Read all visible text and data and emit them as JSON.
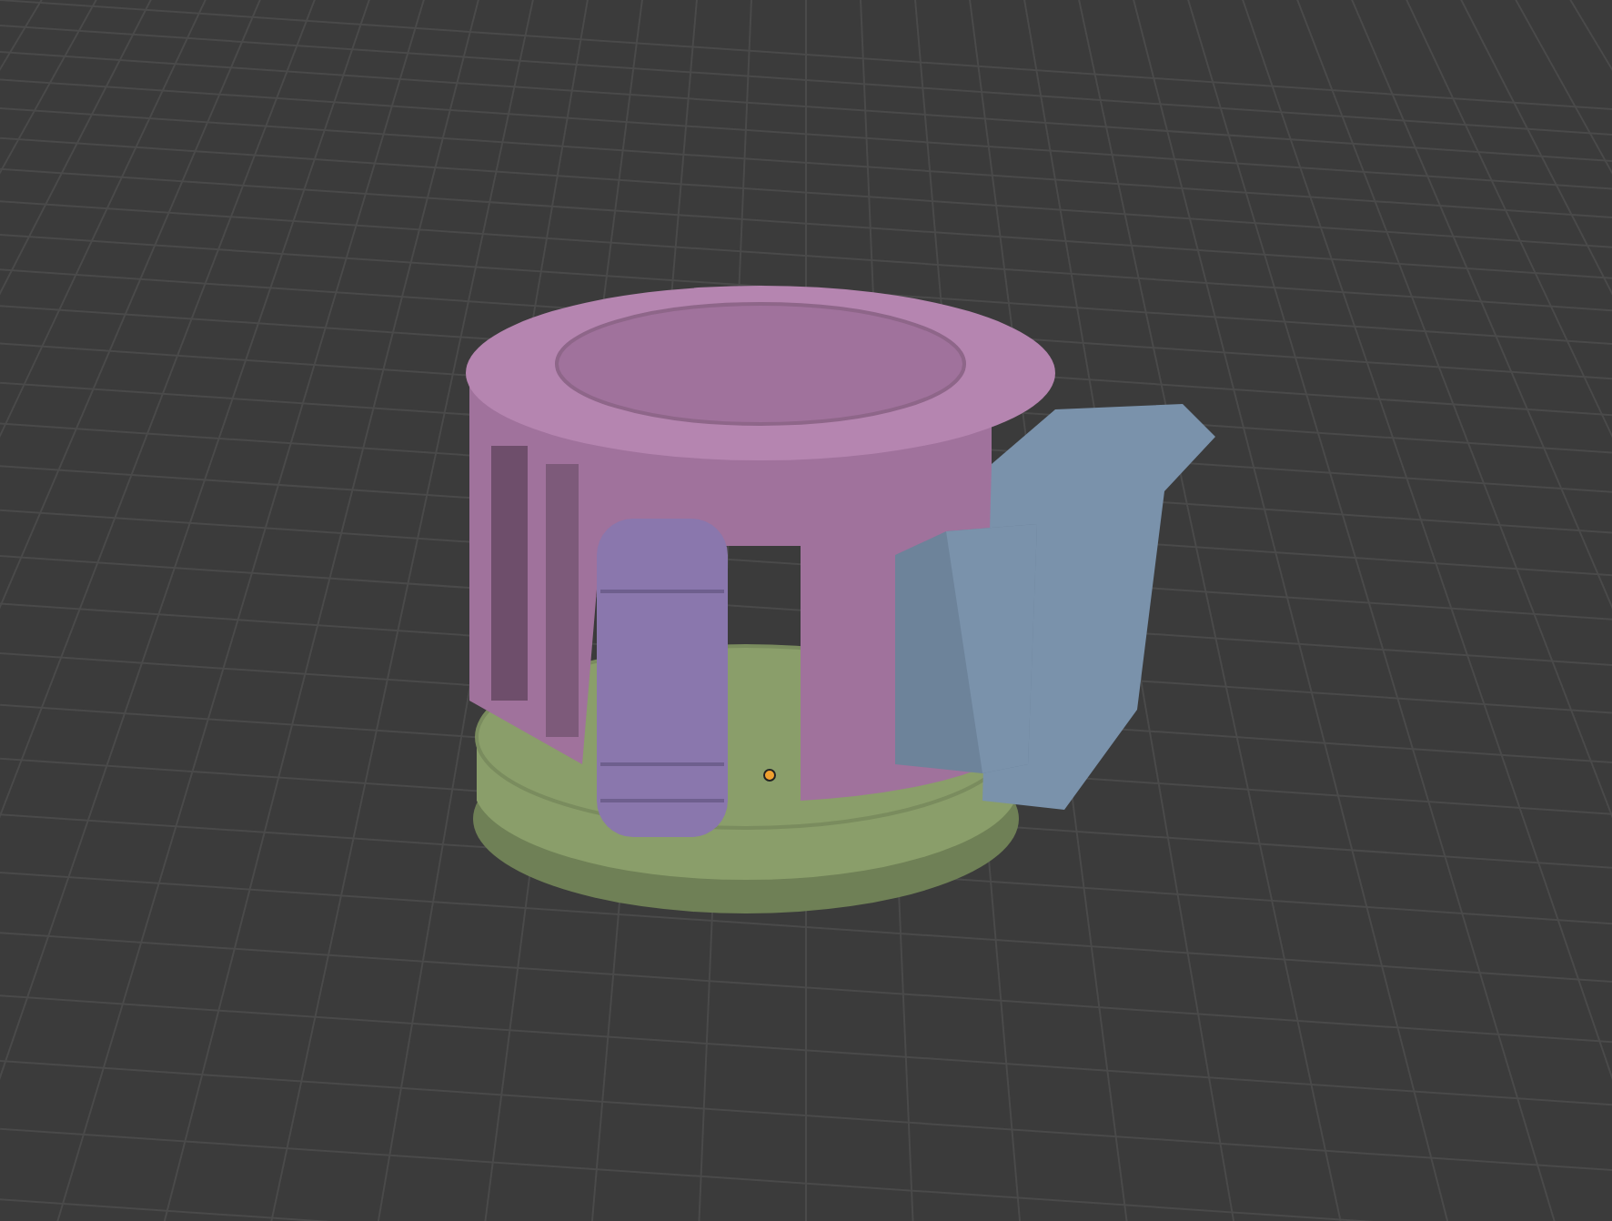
{
  "viewport": {
    "origin_marker": true
  },
  "model": {
    "parts": [
      {
        "kind": "base",
        "color": "#8a9e6a"
      },
      {
        "kind": "body",
        "color": "#a0729c"
      },
      {
        "kind": "roller",
        "color": "#8a77ad"
      },
      {
        "kind": "clamp",
        "color": "#7a92ab"
      }
    ]
  }
}
